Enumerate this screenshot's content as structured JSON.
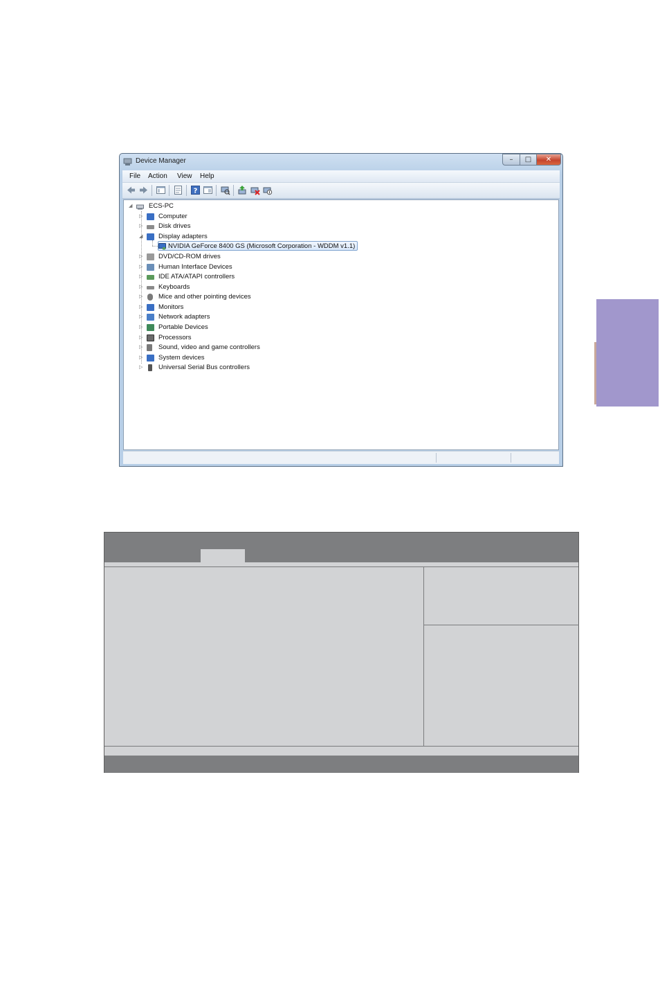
{
  "window": {
    "title": "Device Manager",
    "controls": {
      "minimize": "–",
      "maximize": "□",
      "close": "✕"
    }
  },
  "menu": [
    "File",
    "Action",
    "View",
    "Help"
  ],
  "toolbar_icons": [
    "back-arrow-icon",
    "forward-arrow-icon",
    "show-hide-console-tree-icon",
    "properties-icon",
    "help-icon",
    "action-pane-icon",
    "scan-hardware-icon",
    "update-driver-icon",
    "uninstall-icon",
    "disable-device-icon"
  ],
  "tree": {
    "root": "ECS-PC",
    "categories": [
      {
        "label": "Computer",
        "icon": "computer-icon",
        "color": "#3a6fc4"
      },
      {
        "label": "Disk drives",
        "icon": "disk-drive-icon",
        "color": "#8c8c8c"
      },
      {
        "label": "Display adapters",
        "icon": "display-adapter-icon",
        "color": "#3a6fc4"
      },
      {
        "label": "DVD/CD-ROM drives",
        "icon": "dvd-drive-icon",
        "color": "#9a9a9a"
      },
      {
        "label": "Human Interface Devices",
        "icon": "hid-icon",
        "color": "#6a8fb8"
      },
      {
        "label": "IDE ATA/ATAPI controllers",
        "icon": "ide-controller-icon",
        "color": "#5b9a5b"
      },
      {
        "label": "Keyboards",
        "icon": "keyboard-icon",
        "color": "#8a8a8a"
      },
      {
        "label": "Mice and other pointing devices",
        "icon": "mouse-icon",
        "color": "#7a7a7a"
      },
      {
        "label": "Monitors",
        "icon": "monitor-icon",
        "color": "#3a6fc4"
      },
      {
        "label": "Network adapters",
        "icon": "network-adapter-icon",
        "color": "#4a7fc8"
      },
      {
        "label": "Portable Devices",
        "icon": "portable-device-icon",
        "color": "#3f8a5a"
      },
      {
        "label": "Processors",
        "icon": "processor-icon",
        "color": "#6b6b6b"
      },
      {
        "label": "Sound, video and game controllers",
        "icon": "sound-icon",
        "color": "#7a7a7a"
      },
      {
        "label": "System devices",
        "icon": "system-device-icon",
        "color": "#3a6fc4"
      },
      {
        "label": "Universal Serial Bus controllers",
        "icon": "usb-icon",
        "color": "#555555"
      }
    ],
    "display_adapter_child": "NVIDIA GeForce 8400 GS (Microsoft Corporation - WDDM v1.1)"
  },
  "colors": {
    "side_tab": "#a197cc",
    "bios_header": "#7d7e80",
    "bios_body": "#d2d3d5"
  }
}
